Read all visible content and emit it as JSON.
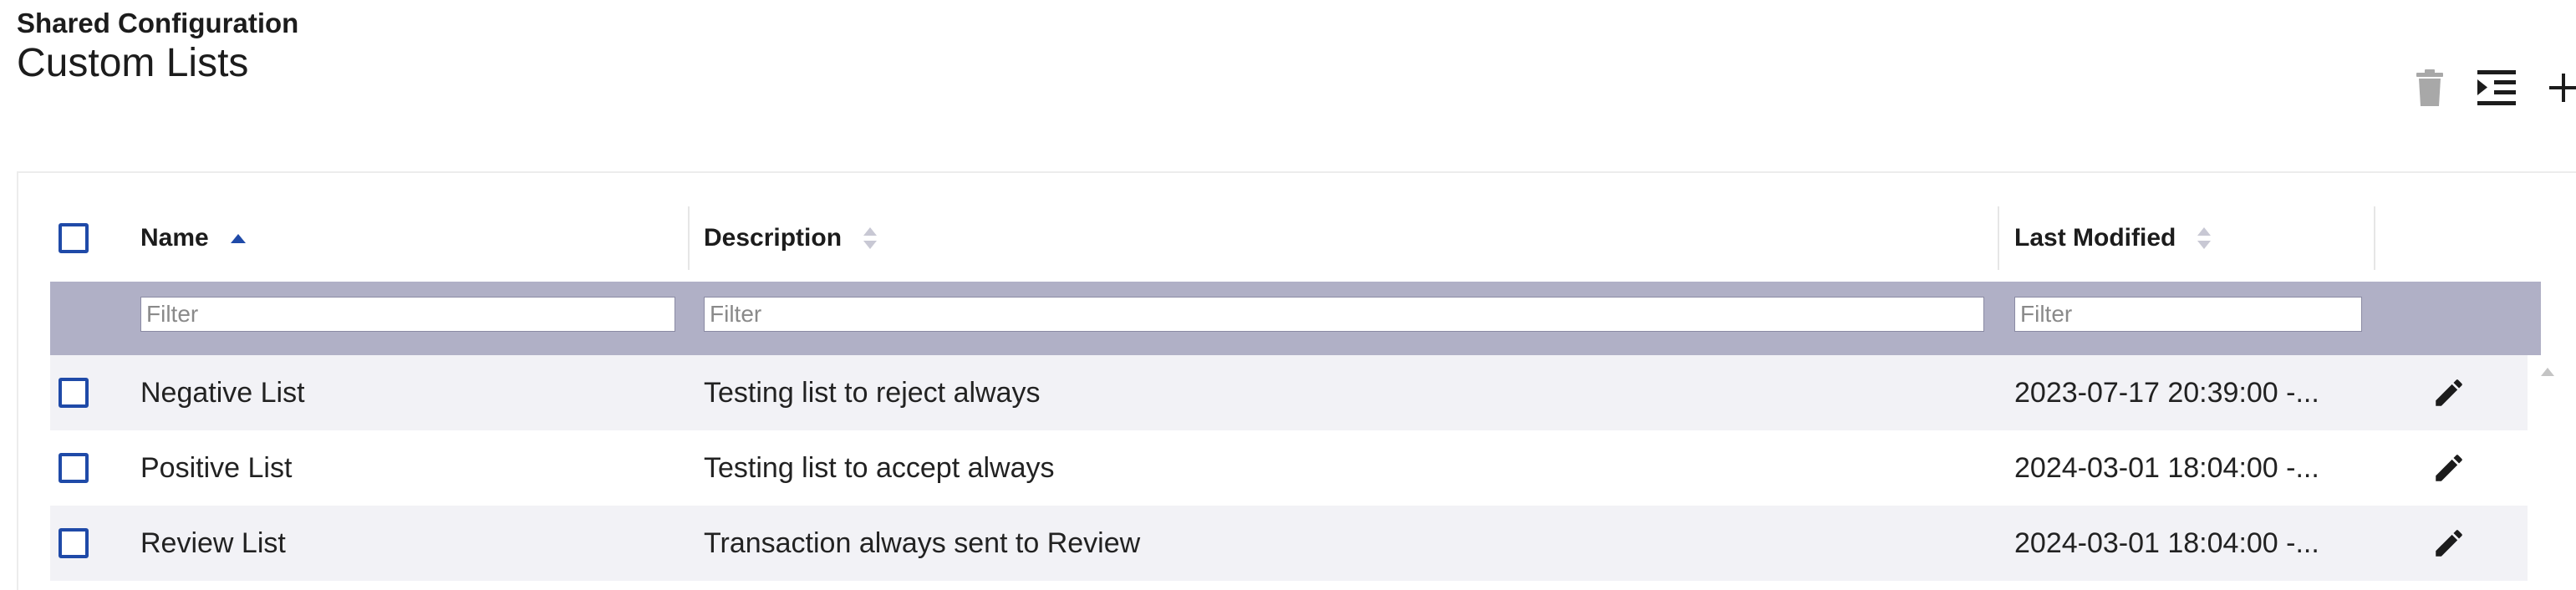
{
  "header": {
    "eyebrow": "Shared Configuration",
    "title": "Custom Lists"
  },
  "toolbar": {
    "delete_icon": "trash-icon",
    "indent_icon": "indent-list-icon",
    "add_icon": "plus-icon"
  },
  "table": {
    "columns": [
      {
        "label": "Name",
        "sort": "ascending"
      },
      {
        "label": "Description",
        "sort": "none"
      },
      {
        "label": "Last Modified",
        "sort": "none"
      }
    ],
    "filters": {
      "name_placeholder": "Filter",
      "description_placeholder": "Filter",
      "modified_placeholder": "Filter"
    },
    "rows": [
      {
        "name": "Negative List",
        "description": "Testing list to reject always",
        "modified": "2023-07-17 20:39:00 -..."
      },
      {
        "name": "Positive List",
        "description": "Testing list to accept always",
        "modified": "2024-03-01 18:04:00 -..."
      },
      {
        "name": "Review List",
        "description": "Transaction always sent to Review",
        "modified": "2024-03-01 18:04:00 -..."
      }
    ]
  },
  "colors": {
    "accent": "#1f4aa8",
    "filter_bar": "#b0b0c6",
    "row_alt": "#f2f2f6",
    "disabled_icon": "#a8a8a8"
  }
}
